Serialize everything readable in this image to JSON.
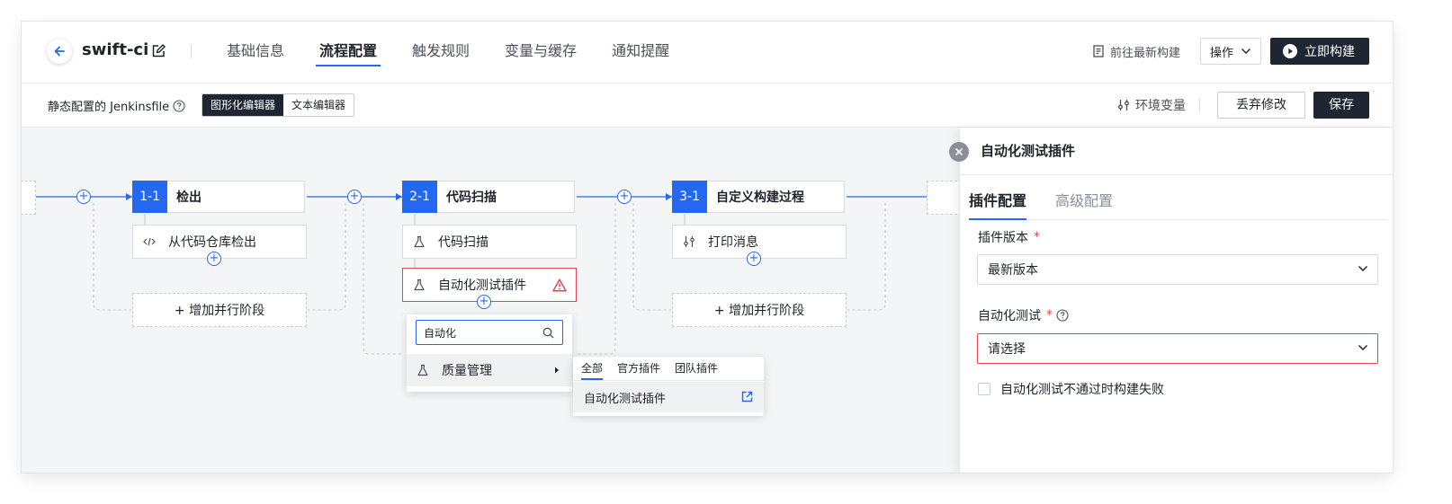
{
  "header": {
    "project_name": "swift-ci",
    "tabs": [
      {
        "label": "基础信息",
        "active": false
      },
      {
        "label": "流程配置",
        "active": true
      },
      {
        "label": "触发规则",
        "active": false
      },
      {
        "label": "变量与缓存",
        "active": false
      },
      {
        "label": "通知提醒",
        "active": false
      }
    ],
    "goto_latest_build": "前往最新构建",
    "operations": "操作",
    "build_now": "立即构建"
  },
  "subbar": {
    "config_label": "静态配置的 Jenkinsfile",
    "editor_modes": [
      "图形化编辑器",
      "文本编辑器"
    ],
    "env_vars": "环境变量",
    "discard": "丢弃修改",
    "save": "保存"
  },
  "pipeline": {
    "stages": [
      {
        "num": "1-1",
        "title": "检出",
        "tasks": [
          "从代码仓库检出"
        ],
        "add_parallel": "+ 增加并行阶段"
      },
      {
        "num": "2-1",
        "title": "代码扫描",
        "tasks": [
          "代码扫描",
          "自动化测试插件"
        ]
      },
      {
        "num": "3-1",
        "title": "自定义构建过程",
        "tasks": [
          "打印消息"
        ],
        "add_parallel": "+ 增加并行阶段"
      }
    ],
    "plugin_picker": {
      "search_value": "自动化",
      "category": "质量管理",
      "tabs": [
        "全部",
        "官方插件",
        "团队插件"
      ],
      "results": [
        "自动化测试插件"
      ]
    }
  },
  "panel": {
    "title": "自动化测试插件",
    "tabs": [
      {
        "label": "插件配置",
        "active": true
      },
      {
        "label": "高级配置",
        "active": false
      }
    ],
    "plugin_version_label": "插件版本",
    "plugin_version_value": "最新版本",
    "auto_test_label": "自动化测试",
    "auto_test_placeholder": "请选择",
    "fail_checkbox_label": "自动化测试不通过时构建失败",
    "required_mark": "*"
  },
  "colors": {
    "accent": "#2468f2",
    "dark_button": "#1f2632",
    "error": "#e64552",
    "canvas_bg": "#f4f5f7"
  }
}
